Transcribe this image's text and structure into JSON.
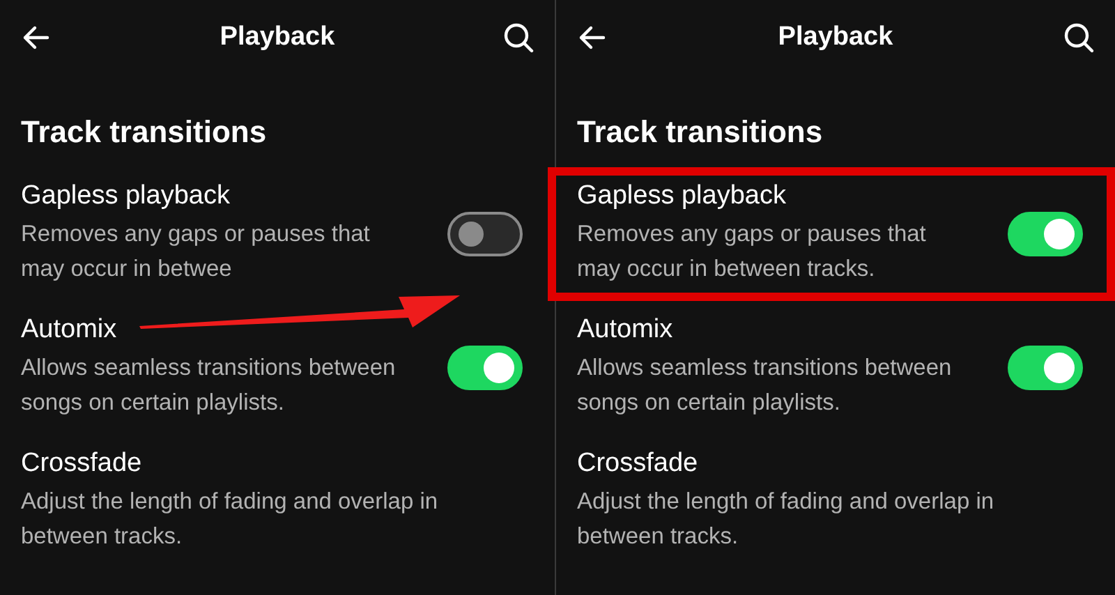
{
  "panels": [
    {
      "title": "Playback",
      "section": "Track transitions",
      "arrow": true,
      "items": [
        {
          "title": "Gapless playback",
          "description_lines": [
            "Removes any gaps or pauses that",
            "may occur in betwee"
          ],
          "kind": "toggle",
          "on": false,
          "highlighted": false
        },
        {
          "title": "Automix",
          "description_lines": [
            "Allows seamless transitions between",
            "songs on certain playlists."
          ],
          "kind": "toggle",
          "on": true,
          "highlighted": false
        },
        {
          "title": "Crossfade",
          "description_lines": [
            "Adjust the length of fading and overlap in",
            "between tracks."
          ],
          "kind": "plain",
          "highlighted": false
        }
      ]
    },
    {
      "title": "Playback",
      "section": "Track transitions",
      "arrow": false,
      "items": [
        {
          "title": "Gapless playback",
          "description_lines": [
            "Removes any gaps or pauses that",
            "may occur in between tracks."
          ],
          "kind": "toggle",
          "on": true,
          "highlighted": true
        },
        {
          "title": "Automix",
          "description_lines": [
            "Allows seamless transitions between",
            "songs on certain playlists."
          ],
          "kind": "toggle",
          "on": true,
          "highlighted": false
        },
        {
          "title": "Crossfade",
          "description_lines": [
            "Adjust the length of fading and overlap in",
            "between tracks."
          ],
          "kind": "plain",
          "highlighted": false
        }
      ]
    }
  ]
}
